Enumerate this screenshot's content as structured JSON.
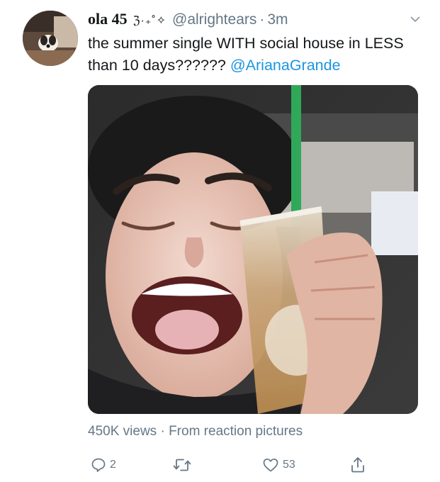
{
  "tweet": {
    "display_name": "ola 45",
    "name_decoration": "ℨ·₊˚✧",
    "handle": "@alrightears",
    "separator": "·",
    "time": "3m",
    "text_before": "the summer single WITH social house in LESS than 10 days?????? ",
    "mention": "@ArianaGrande",
    "views": "450K views",
    "meta_separator": " · ",
    "source": "From reaction pictures",
    "reply_count": "2",
    "like_count": "53"
  },
  "icons": {
    "caret": "chevron-down-icon",
    "reply": "reply-icon",
    "retweet": "retweet-icon",
    "like": "heart-icon",
    "share": "share-icon"
  },
  "colors": {
    "link": "#1b95e0",
    "secondary_text": "#657786",
    "primary_text": "#14171a"
  }
}
